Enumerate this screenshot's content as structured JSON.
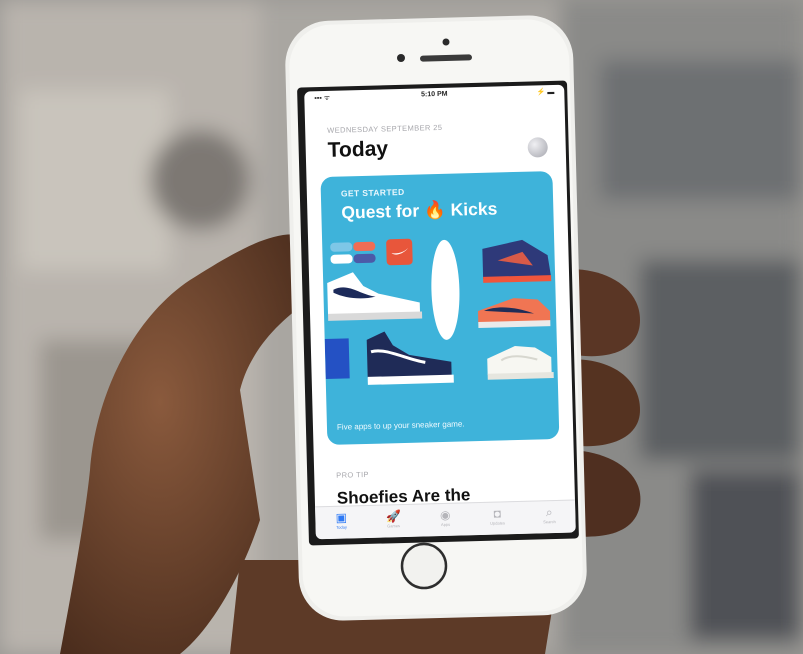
{
  "status_bar": {
    "signal": "▪▪▪ ᯤ",
    "time": "5:10 PM",
    "battery": "⚡ ▬"
  },
  "today": {
    "date": "WEDNESDAY SEPTEMBER 25",
    "title": "Today"
  },
  "card": {
    "eyebrow": "GET STARTED",
    "title_before": "Quest for ",
    "title_emoji": "🔥",
    "title_after": " Kicks",
    "caption": "Five apps to up your sneaker game."
  },
  "next_story": {
    "eyebrow": "PRO TIP",
    "title": "Shoefies Are the"
  },
  "tab_bar": {
    "tabs": [
      {
        "icon": "today-icon",
        "glyph": "▣",
        "label": "Today",
        "active": true
      },
      {
        "icon": "games-icon",
        "glyph": "🚀",
        "label": "Games",
        "active": false
      },
      {
        "icon": "apps-icon",
        "glyph": "◉",
        "label": "Apps",
        "active": false
      },
      {
        "icon": "updates-icon",
        "glyph": "◘",
        "label": "Updates",
        "active": false
      },
      {
        "icon": "search-icon",
        "glyph": "⌕",
        "label": "Search",
        "active": false
      }
    ]
  },
  "colors": {
    "card_blue": "#3eb3da",
    "active_tab": "#2f7af5",
    "phone_body": "#efefec"
  }
}
